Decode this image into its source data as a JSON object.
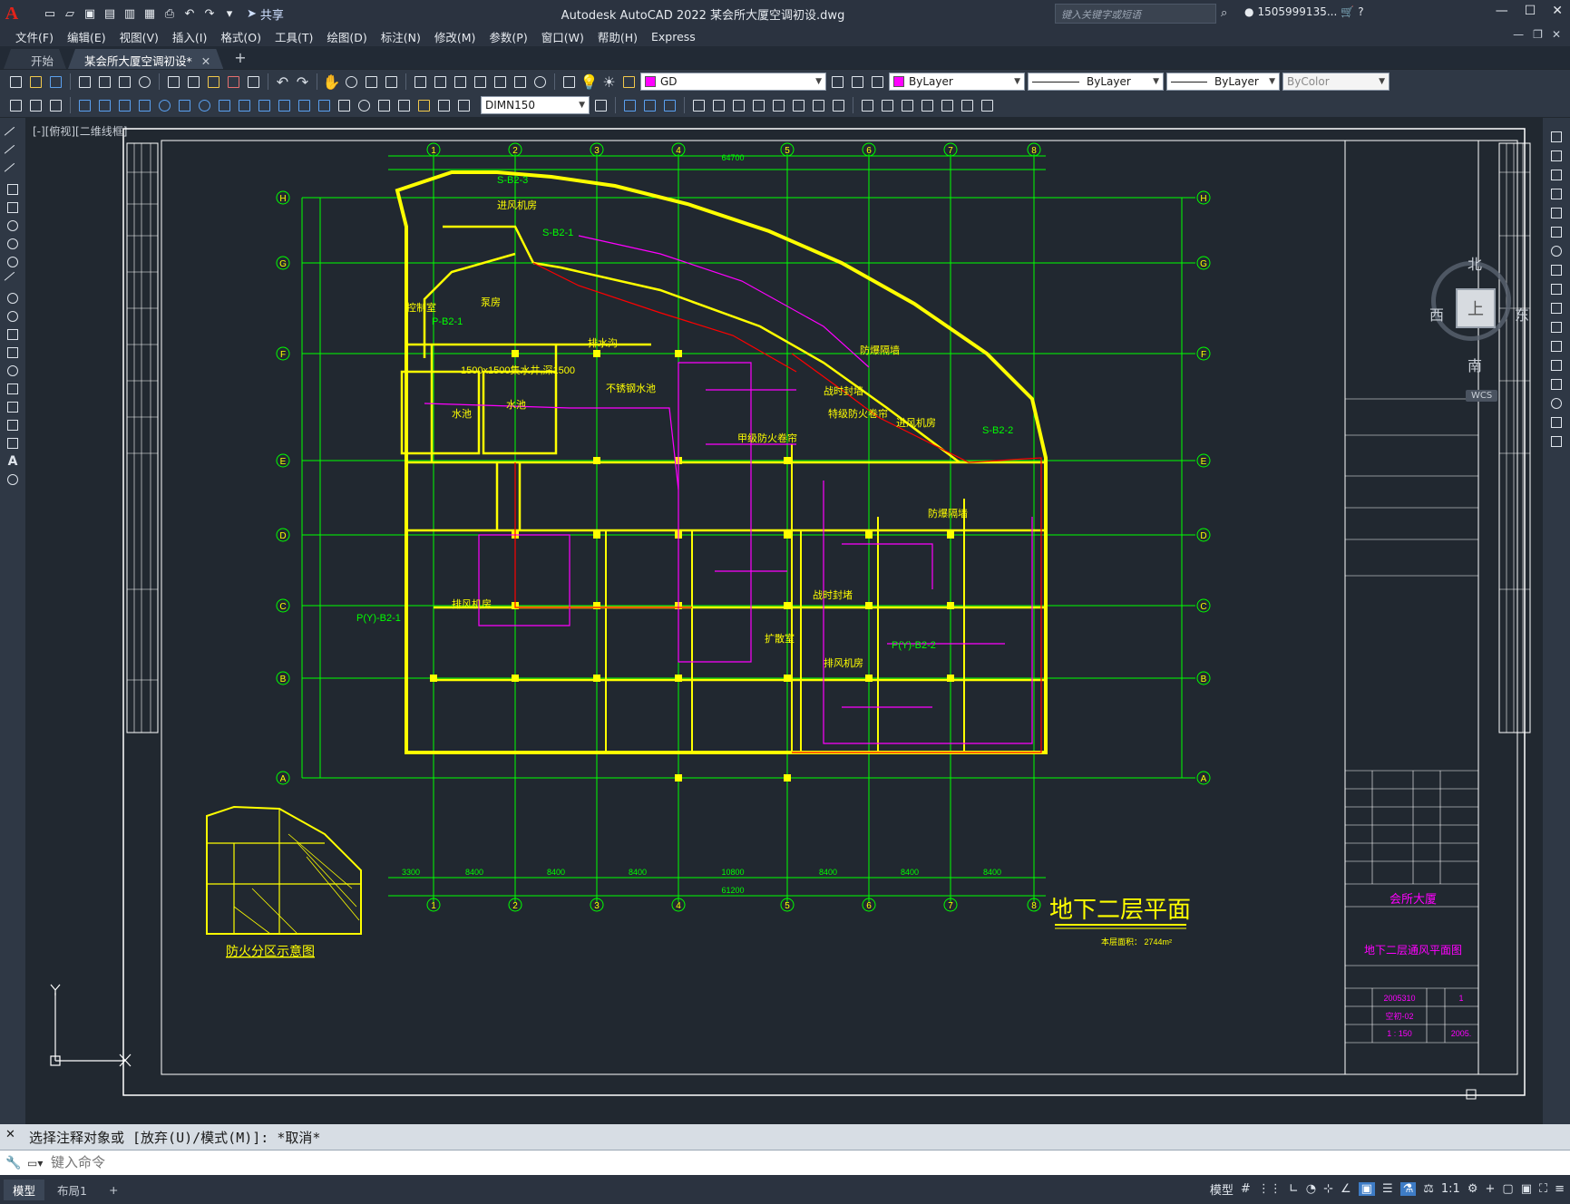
{
  "app": {
    "logo": "A",
    "title": "Autodesk AutoCAD 2022    某会所大厦空调初设.dwg",
    "search_placeholder": "键入关键字或短语",
    "user": "1505999135...",
    "share": "共享"
  },
  "menu": [
    "文件(F)",
    "编辑(E)",
    "视图(V)",
    "插入(I)",
    "格式(O)",
    "工具(T)",
    "绘图(D)",
    "标注(N)",
    "修改(M)",
    "参数(P)",
    "窗口(W)",
    "帮助(H)",
    "Express"
  ],
  "tabs": {
    "start": "开始",
    "active": "某会所大厦空调初设*"
  },
  "toolbar": {
    "layer": "GD",
    "color": "ByLayer",
    "linetype": "ByLayer",
    "lineweight": "ByLayer",
    "plotstyle": "ByColor",
    "dimstyle": "DIMN150"
  },
  "viewport": {
    "label": "[-][俯视][二维线框]",
    "viewcube": {
      "top": "上",
      "north": "北",
      "south": "南",
      "west": "西",
      "east": "东",
      "wcs": "WCS"
    }
  },
  "drawing": {
    "main_title": "地下二层平面",
    "area_note": "本层面积： 2744m²",
    "fire_title": "防火分区示意图",
    "titleblock_project": "会所大厦",
    "titleblock_drawing": "地下二层通风平面图",
    "titleblock_no": "2005310",
    "titleblock_code": "空初-02",
    "titleblock_scale": "1 : 150",
    "titleblock_date": "2005.",
    "titleblock_sheet": "1",
    "col_labels": [
      "1",
      "2",
      "3",
      "4",
      "5",
      "6",
      "7",
      "8"
    ],
    "row_labels": [
      "H",
      "G",
      "F",
      "E",
      "D",
      "C",
      "B",
      "A"
    ],
    "overall_dim_top": "64700",
    "overall_dim_bottom": "61200",
    "bottom_dims": [
      "3300",
      "8400",
      "8400",
      "8400",
      "10800",
      "8400",
      "8400",
      "8400"
    ],
    "rooms": [
      "1500x1500集水井,深1500",
      "水池",
      "水池",
      "不锈钢水池",
      "排水沟",
      "控制室",
      "泵房",
      "进风机房",
      "排风机房",
      "战时封墙",
      "战时封堵",
      "防爆隔墙",
      "特级防火卷帘",
      "甲级防火卷帘",
      "扩散室",
      "进风机房",
      "排风机房",
      "防爆隔墙",
      "P(Y)-B2-1",
      "P(Y)-B2-2",
      "S-B2-1",
      "S-B2-2",
      "S-B2-3",
      "P-B2-1"
    ]
  },
  "command": {
    "history": "选择注释对象或 [放弃(U)/模式(M)]: *取消*",
    "placeholder": "键入命令"
  },
  "status": {
    "model_tab": "模型",
    "layout_tab": "布局1",
    "model_label": "模型",
    "scale": "1:1"
  },
  "colors": {
    "yellow": "#ffff00",
    "green": "#00ff00",
    "magenta": "#ff00ff",
    "red": "#ff0000",
    "white": "#ffffff",
    "bg": "#212830"
  }
}
